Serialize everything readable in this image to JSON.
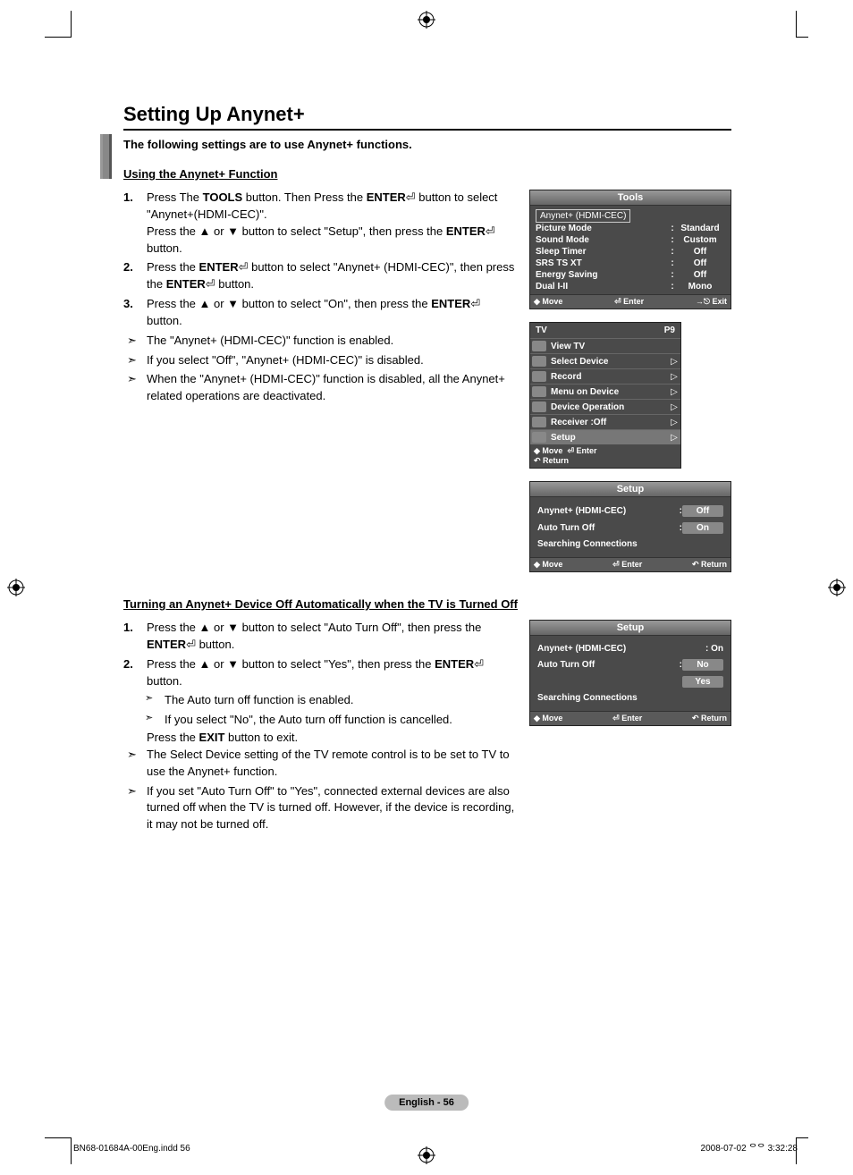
{
  "title": "Setting Up Anynet+",
  "intro": "The following settings are to use Anynet+ functions.",
  "section1": {
    "heading": "Using the Anynet+ Function",
    "steps": [
      {
        "n": "1.",
        "text": "Press The <b>TOOLS</b> button. Then Press the <b>ENTER</b>⏎ button to select \"Anynet+(HDMI-CEC)\".<br>Press the ▲ or ▼ button to select \"Setup\", then press the <b>ENTER</b>⏎ button."
      },
      {
        "n": "2.",
        "text": "Press the <b>ENTER</b>⏎ button to select \"Anynet+ (HDMI-CEC)\", then press the <b>ENTER</b>⏎ button."
      },
      {
        "n": "3.",
        "text": "Press the ▲ or ▼ button to select \"On\", then press the <b>ENTER</b>⏎ button."
      }
    ],
    "notes": [
      "The \"Anynet+ (HDMI-CEC)\" function is enabled.",
      "If you select \"Off\", \"Anynet+ (HDMI-CEC)\" is disabled.",
      "When the \"Anynet+ (HDMI-CEC)\" function is disabled, all the Anynet+ related operations are deactivated."
    ]
  },
  "section2": {
    "heading": "Turning an Anynet+ Device Off Automatically when the TV is Turned Off",
    "steps": [
      {
        "n": "1.",
        "text": "Press the ▲ or ▼ button to select \"Auto Turn Off\", then press the <b>ENTER</b>⏎ button."
      },
      {
        "n": "2.",
        "text": "Press the ▲ or ▼ button to select \"Yes\", then press the <b>ENTER</b>⏎ button."
      }
    ],
    "subnotes": [
      "The Auto turn off function is enabled.",
      "If you select \"No\", the Auto turn off function is cancelled."
    ],
    "tail": "Press the <b>EXIT</b> button to exit.",
    "notes": [
      "The Select Device setting of the TV remote control is to be set to TV to use the Anynet+ function.",
      "If you set \"Auto Turn Off\" to \"Yes\", connected external devices are also turned off when the TV is turned off. However, if the device is recording, it may not be turned off."
    ]
  },
  "osd_tools": {
    "title": "Tools",
    "highlight": "Anynet+ (HDMI-CEC)",
    "rows": [
      {
        "lab": "Picture Mode",
        "val": "Standard"
      },
      {
        "lab": "Sound Mode",
        "val": "Custom"
      },
      {
        "lab": "Sleep Timer",
        "val": "Off"
      },
      {
        "lab": "SRS TS XT",
        "val": "Off"
      },
      {
        "lab": "Energy Saving",
        "val": "Off"
      },
      {
        "lab": "Dual I-II",
        "val": "Mono"
      }
    ],
    "nav": {
      "move": "Move",
      "enter": "Enter",
      "exit": "Exit"
    }
  },
  "osd_anynet": {
    "tv": "TV",
    "ch": "P9",
    "items": [
      {
        "t": "View TV",
        "a": false
      },
      {
        "t": "Select Device",
        "a": true
      },
      {
        "t": "Record",
        "a": true
      },
      {
        "t": "Menu on Device",
        "a": true
      },
      {
        "t": "Device Operation",
        "a": true
      },
      {
        "t": "Receiver      :Off",
        "a": true
      },
      {
        "t": "Setup",
        "a": true,
        "hl": true
      }
    ],
    "nav": {
      "move": "Move",
      "enter": "Enter",
      "return": "Return"
    }
  },
  "osd_setup1": {
    "title": "Setup",
    "rows": [
      {
        "lab": "Anynet+ (HDMI-CEC)",
        "val": "Off",
        "box": true
      },
      {
        "lab": "Auto Turn Off",
        "val": "On",
        "box": true
      },
      {
        "lab": "Searching Connections",
        "val": "",
        "box": false
      }
    ],
    "nav": {
      "move": "Move",
      "enter": "Enter",
      "return": "Return"
    }
  },
  "osd_setup2": {
    "title": "Setup",
    "rows": [
      {
        "lab": "Anynet+ (HDMI-CEC)",
        "val": ": On",
        "box": false
      },
      {
        "lab": "Auto Turn Off",
        "val": "No",
        "box": true,
        "prefix": ":"
      },
      {
        "lab": "",
        "val": "Yes",
        "box": true
      },
      {
        "lab": "Searching Connections",
        "val": "",
        "box": false
      }
    ],
    "nav": {
      "move": "Move",
      "enter": "Enter",
      "return": "Return"
    }
  },
  "page_badge": "English - 56",
  "footer_left": "BN68-01684A-00Eng.indd   56",
  "footer_right": "2008-07-02   ᄋᄋ 3:32:28"
}
